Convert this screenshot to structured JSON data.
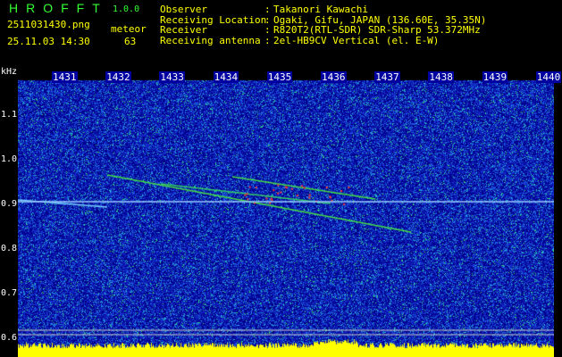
{
  "app": {
    "title": "HROFFT",
    "version": "1.0.0"
  },
  "file": {
    "name": "2511031430.png",
    "datetime": "25.11.03 14:30"
  },
  "meteor": {
    "label": "meteor",
    "count": "63"
  },
  "info": [
    {
      "label": "Observer",
      "value": "Takanori Kawachi"
    },
    {
      "label": "Receiving Location",
      "value": "Ogaki, Gifu, JAPAN (136.60E, 35.35N)"
    },
    {
      "label": "Receiver",
      "value": "R820T2(RTL-SDR) SDR-Sharp 53.372MHz"
    },
    {
      "label": "Receiving antenna",
      "value": "2el-HB9CV Vertical (el. E-W)"
    }
  ],
  "axis": {
    "unit": "kHz",
    "x_ticks": [
      "1431",
      "1432",
      "1433",
      "1434",
      "1435",
      "1436",
      "1437",
      "1438",
      "1439",
      "1440"
    ],
    "y_ticks": [
      "1.1",
      "1.0",
      "0.9",
      "0.8",
      "0.7",
      "0.6"
    ]
  }
}
